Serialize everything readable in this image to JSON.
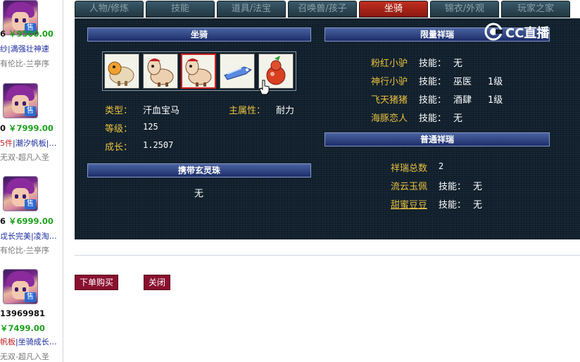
{
  "tabs": [
    {
      "label": "人物/修炼"
    },
    {
      "label": "技能"
    },
    {
      "label": "道具/法宝"
    },
    {
      "label": "召唤兽/孩子"
    },
    {
      "label": "坐骑",
      "active": true
    },
    {
      "label": "锦衣/外观"
    },
    {
      "label": "玩家之家"
    }
  ],
  "left_listings": [
    {
      "price_prefix": "6",
      "price": "￥9500.00",
      "desc": "纱|満强壮神速",
      "desc_red": "",
      "seller": "有伦比-兰亭序"
    },
    {
      "price_prefix": "0",
      "price": "￥7999.00",
      "desc": "|潮汐帆板|…",
      "desc_red": "5件",
      "seller": "无双-超凡入圣"
    },
    {
      "price_prefix": "6",
      "price": "￥6999.00",
      "desc": "戉长完美|凌淘…",
      "desc_red": "",
      "seller": "有伦比-兰亭序"
    },
    {
      "price_prefix": "13969981",
      "price": "￥7499.00",
      "desc": "|坐骑成长…",
      "desc_red": "帆板",
      "seller": "无双-超凡入圣"
    }
  ],
  "sell_badge": "售",
  "mount_section": {
    "header": "坐骑",
    "slots": [
      {
        "icon": "sheep-mount-icon"
      },
      {
        "icon": "horse-mount-icon"
      },
      {
        "icon": "horse-mount-icon",
        "selected": true
      },
      {
        "icon": "blue-fish-mount-icon"
      },
      {
        "icon": "red-gourd-mount-icon"
      }
    ],
    "type_label": "类型：",
    "type_value": "汗血宝马",
    "main_attr_label": "主属性：",
    "main_attr_value": "耐力",
    "level_label": "等级：",
    "level_value": "125",
    "growth_label": "成长：",
    "growth_value": "1.2507"
  },
  "orb_section": {
    "header": "携带玄灵珠",
    "value": "无"
  },
  "limited_section": {
    "header": "限量祥瑞",
    "items": [
      {
        "name": "粉红小驴",
        "skill_label": "技能：",
        "skill": "无",
        "level": ""
      },
      {
        "name": "神行小驴",
        "skill_label": "技能：",
        "skill": "巫医",
        "level": "1级"
      },
      {
        "name": "飞天猪猪",
        "skill_label": "技能：",
        "skill": "酒肆",
        "level": "1级"
      },
      {
        "name": "海豚恋人",
        "skill_label": "技能：",
        "skill": "无",
        "level": ""
      }
    ]
  },
  "common_section": {
    "header": "普通祥瑞",
    "total_label": "祥瑞总数",
    "total_value": "2",
    "items": [
      {
        "name": "流云玉佩",
        "skill_label": "技能：",
        "skill": "无"
      },
      {
        "name": "甜蜜豆豆",
        "skill_label": "技能：",
        "skill": "无"
      }
    ]
  },
  "logo": {
    "text": "CC直播"
  },
  "buttons": {
    "buy": "下单购买",
    "close": "关闭"
  },
  "colors": {
    "panel_bg": "#0f1e2a",
    "gold_text": "#e8c040",
    "active_tab": "#c03020",
    "button": "#8a1030",
    "price_green": "#1ca11c"
  }
}
